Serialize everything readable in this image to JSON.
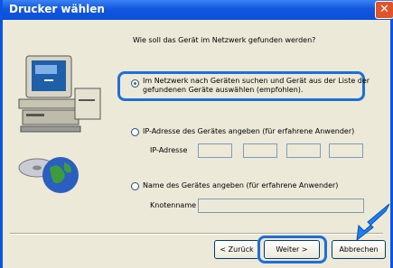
{
  "window": {
    "title": "Drucker wählen",
    "close_glyph": "✕"
  },
  "question": "Wie soll das Gerät im Netzwerk gefunden werden?",
  "options": [
    {
      "line1": "Im Netzwerk nach Geräten suchen und Gerät aus der Liste der",
      "line2": "gefundenen Geräte auswählen (empfohlen).",
      "selected": true
    },
    {
      "label": "IP-Adresse des Gerätes angeben (für erfahrene Anwender)",
      "selected": false
    },
    {
      "label": "Name des Gerätes angeben (für erfahrene Anwender)",
      "selected": false
    }
  ],
  "ip": {
    "label": "IP-Adresse"
  },
  "node": {
    "label": "Knotenname"
  },
  "buttons": {
    "back": "< Zurück",
    "next": "Weiter >",
    "cancel": "Abbrechen"
  },
  "colors": {
    "title_bar": "#0a55e5",
    "highlight": "#1f6fd8",
    "arrow": "#1e7ff0"
  }
}
